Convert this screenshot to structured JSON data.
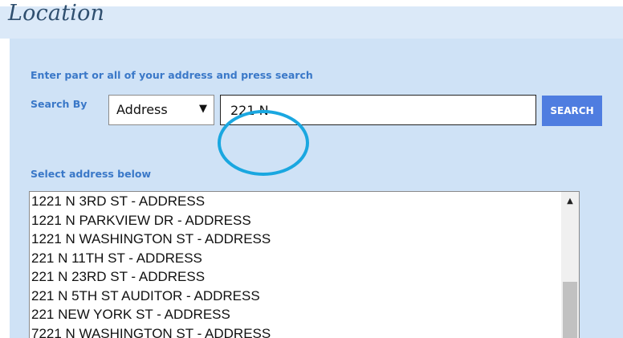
{
  "header": {
    "title": "Location"
  },
  "form": {
    "instruction": "Enter part or all of your address and press search",
    "search_by_label": "Search By",
    "search_by_selected": "Address",
    "dropdown_arrow": "▼",
    "search_value": "221 N",
    "search_button_label": "SEARCH"
  },
  "results": {
    "label": "Select address below",
    "items": [
      "1221 N 3RD ST - ADDRESS",
      "1221 N PARKVIEW DR - ADDRESS",
      "1221 N WASHINGTON ST - ADDRESS",
      "221 N 11TH ST - ADDRESS",
      "221 N 23RD ST - ADDRESS",
      "221 N 5TH ST AUDITOR - ADDRESS",
      "221 NEW YORK ST - ADDRESS",
      "7221 N WASHINGTON ST - ADDRESS"
    ],
    "scroll_up_glyph": "▲",
    "scroll_position": 0.55
  },
  "colors": {
    "title": "#2f4f6f",
    "panel_background": "#cfe2f6",
    "label_blue": "#3a78c8",
    "button_blue": "#4f7de0",
    "annotation_circle": "#1aa7e0"
  },
  "icons": {
    "dropdown": "triangle-down-icon",
    "scroll_up": "triangle-up-icon",
    "annotation": "highlight-circle"
  }
}
